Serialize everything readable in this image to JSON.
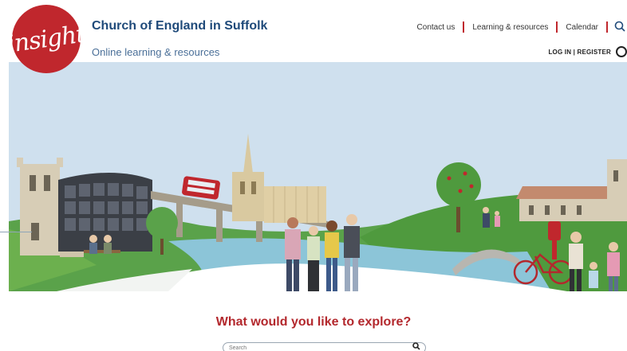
{
  "header": {
    "logo_text": "insight",
    "title": "Church of England in Suffolk",
    "subtitle": "Online learning & resources"
  },
  "topnav": {
    "items": [
      {
        "label": "Contact us"
      },
      {
        "label": "Learning & resources"
      },
      {
        "label": "Calendar"
      }
    ],
    "search_icon": "search-icon"
  },
  "account": {
    "label": "LOG IN | REGISTER",
    "icon": "user-icon"
  },
  "hero": {
    "image_name": "suffolk-illustration-banner"
  },
  "explore": {
    "title": "What would you like to explore?",
    "search_placeholder": "Search",
    "search_icon": "search-icon"
  },
  "colors": {
    "brand_red": "#c0272d",
    "title_blue": "#1f4a7a",
    "sky": "#cfe0ee",
    "grass": "#3e8e3a"
  }
}
